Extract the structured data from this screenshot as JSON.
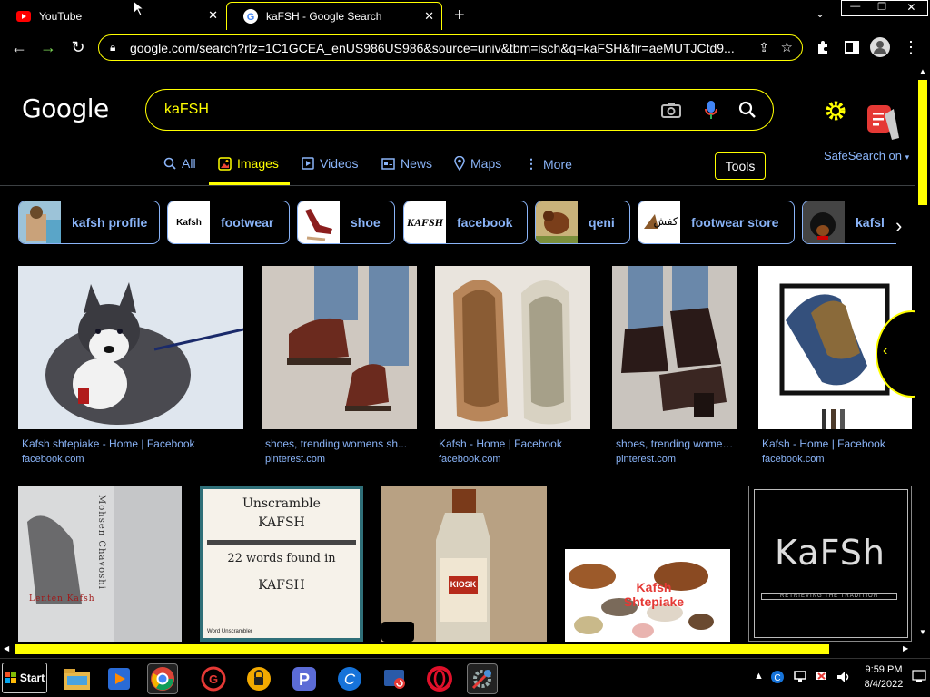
{
  "browser": {
    "tabs": [
      {
        "title": "YouTube",
        "icon": "youtube-icon",
        "active": false
      },
      {
        "title": "kaFSH - Google Search",
        "icon": "google-icon",
        "active": true
      }
    ],
    "url": "google.com/search?rlz=1C1GCEA_enUS986US986&source=univ&tbm=isch&q=kaFSH&fir=aeMUTJCtd9..."
  },
  "google": {
    "logo": "Google",
    "query": "kaFSH",
    "nav": [
      {
        "label": "All",
        "icon": "search-icon"
      },
      {
        "label": "Images",
        "icon": "image-icon"
      },
      {
        "label": "Videos",
        "icon": "video-icon"
      },
      {
        "label": "News",
        "icon": "news-icon"
      },
      {
        "label": "Maps",
        "icon": "map-pin-icon"
      },
      {
        "label": "More",
        "icon": "more-vert-icon"
      }
    ],
    "active_nav": "Images",
    "tools_label": "Tools",
    "safesearch_label": "SafeSearch on",
    "chips": [
      "kafsh profile",
      "footwear",
      "shoe",
      "facebook",
      "qeni",
      "footwear store",
      "kafsl"
    ],
    "chip_thumb_text": {
      "footwear": "Kafsh",
      "facebook": "KAFSH"
    }
  },
  "results_row1": [
    {
      "title": "Kafsh shtepiake - Home | Facebook",
      "source": "facebook.com"
    },
    {
      "title": "shoes, trending womens sh...",
      "source": "pinterest.com"
    },
    {
      "title": "Kafsh - Home | Facebook",
      "source": "facebook.com"
    },
    {
      "title": "shoes, trending women...",
      "source": "pinterest.com"
    },
    {
      "title": "Kafsh - Home | Facebook",
      "source": "facebook.com"
    }
  ],
  "results_row2_text": {
    "book_title_side": "Mohsen Chavoshi",
    "book_caption": "Lenten Kafsh",
    "unscramble_line1": "Unscramble",
    "unscramble_line2": "KAFSH",
    "unscramble_line3": "22 words found in",
    "unscramble_line4": "KAFSH",
    "unscramble_brand": "Word Unscrambler",
    "bottle_label": "KIOSK",
    "animals_caption": "Kafsh Shtepiake",
    "logo_word": "KaFSh",
    "logo_tagline": "RETRIEVING THE TRADITION"
  },
  "taskbar": {
    "start_label": "Start",
    "time": "9:59 PM",
    "date": "8/4/2022"
  },
  "colors": {
    "accent": "#ffff00",
    "link": "#8ab4f8",
    "bg": "#000000"
  }
}
